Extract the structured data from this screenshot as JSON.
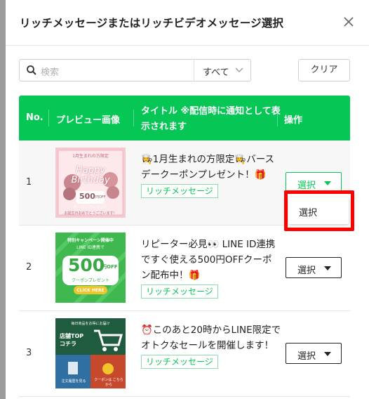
{
  "dialog": {
    "title": "リッチメッセージまたはリッチビデオメッセージ選択"
  },
  "toolbar": {
    "search_placeholder": "検索",
    "filter_value": "すべて",
    "clear_label": "クリア"
  },
  "table": {
    "columns": [
      "No.",
      "プレビュー画像",
      "タイトル ※配信時に通知として表示されます",
      "操作"
    ],
    "rows": [
      {
        "no": "1",
        "title": "👩‍🍳1月生まれの方限定👩‍🍳バースデークーポンプレゼント！🎁",
        "type": "リッチメッセージ",
        "action": "選択",
        "thumb": {
          "top_text": "1月生まれの方限定",
          "script": "Happy Birthday",
          "amount": "500",
          "unit": "円OFF",
          "coupon": "クーポンプレゼント",
          "footer": "お誕生日おめでとうございます！"
        }
      },
      {
        "no": "2",
        "title": "リピーター必見👀 LINE ID連携ですぐ使える500円OFFクーポン配布中！🎁",
        "type": "リッチメッセージ",
        "action": "選択",
        "thumb": {
          "top_text": "特別キャンペーン開催中",
          "sub_text": "LINE ID連携で",
          "amount": "500",
          "unit": "円OFF",
          "coupon": "クーポンプレゼント",
          "cta": "CLICK HERE"
        }
      },
      {
        "no": "3",
        "title": "⏰このあと20時からLINE限定でオトクなセールを開催します！",
        "type": "リッチメッセージ",
        "action": "選択",
        "thumb": {
          "top_text": "毎日商品をお得にお届け",
          "shop_label": "店舗TOP",
          "shop_sub": "コチラ",
          "history_label": "注文履歴を見る",
          "coupon_label": "クーポンは こちらから"
        }
      }
    ]
  },
  "dropdown": {
    "item_label": "選択"
  },
  "colors": {
    "accent": "#06c755",
    "highlight": "#ff0000"
  }
}
